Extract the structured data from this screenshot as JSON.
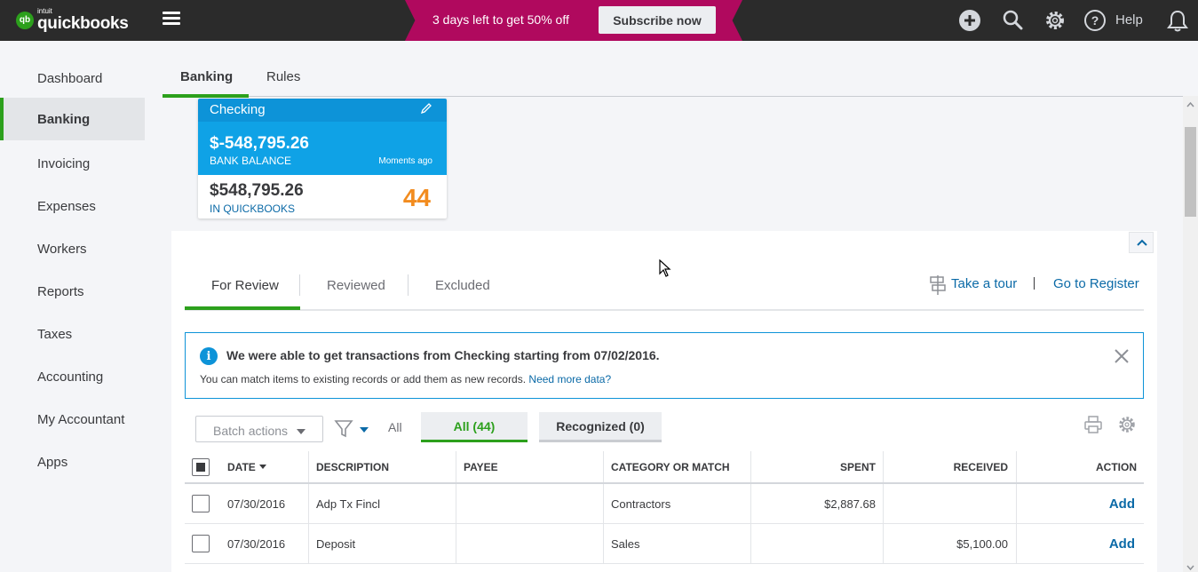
{
  "header": {
    "logo_small": "intuit",
    "logo_main": "quickbooks",
    "logo_mark": "qb",
    "promo_text": "3 days left to get 50% off",
    "promo_button": "Subscribe now",
    "help_label": "Help",
    "promo_color": "#b0095e",
    "icons": [
      "plus-icon",
      "search-icon",
      "gear-icon",
      "help-icon",
      "bell-icon"
    ]
  },
  "sidebar": {
    "items": [
      {
        "label": "Dashboard"
      },
      {
        "label": "Banking",
        "active": true
      },
      {
        "label": "Invoicing"
      },
      {
        "label": "Expenses"
      },
      {
        "label": "Workers"
      },
      {
        "label": "Reports"
      },
      {
        "label": "Taxes"
      },
      {
        "label": "Accounting"
      },
      {
        "label": "My Accountant"
      },
      {
        "label": "Apps"
      }
    ]
  },
  "page_tabs": [
    {
      "label": "Banking",
      "active": true
    },
    {
      "label": "Rules"
    }
  ],
  "account_card": {
    "name": "Checking",
    "bank_balance": "$-548,795.26",
    "bank_balance_label": "BANK BALANCE",
    "updated": "Moments ago",
    "qb_balance": "$548,795.26",
    "qb_balance_label": "IN QUICKBOOKS",
    "pending_count": "44"
  },
  "review_tabs": [
    {
      "label": "For Review",
      "active": true
    },
    {
      "label": "Reviewed"
    },
    {
      "label": "Excluded"
    }
  ],
  "links": {
    "tour": "Take a tour",
    "register": "Go to Register"
  },
  "banner": {
    "title": "We were able to get transactions from Checking starting from 07/02/2016.",
    "text": "You can match items to existing records or add them as new records.",
    "link": "Need more data?"
  },
  "toolbar": {
    "batch_actions": "Batch actions",
    "filter_all": "All",
    "pill_all": "All (44)",
    "pill_recognized": "Recognized (0)"
  },
  "table": {
    "columns": [
      "DATE",
      "DESCRIPTION",
      "PAYEE",
      "CATEGORY OR MATCH",
      "SPENT",
      "RECEIVED",
      "ACTION"
    ],
    "rows": [
      {
        "date": "07/30/2016",
        "description": "Adp Tx Fincl",
        "payee": "",
        "category": "Contractors",
        "spent": "$2,887.68",
        "received": "",
        "action": "Add"
      },
      {
        "date": "07/30/2016",
        "description": "Deposit",
        "payee": "",
        "category": "Sales",
        "spent": "",
        "received": "$5,100.00",
        "action": "Add"
      }
    ]
  }
}
